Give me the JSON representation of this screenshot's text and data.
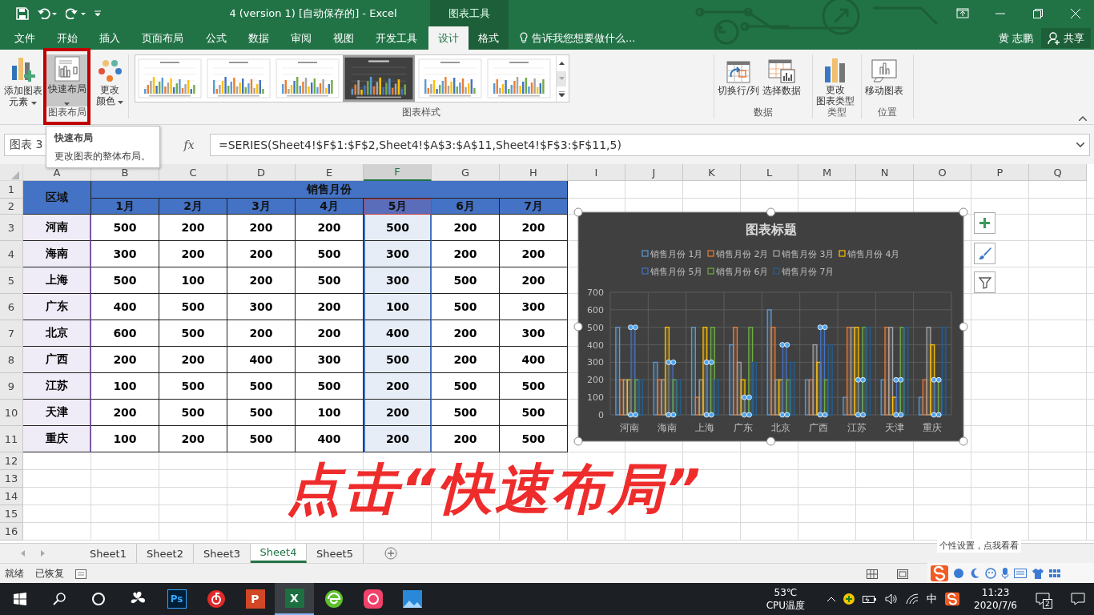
{
  "title_bar": {
    "title": "4 (version 1) [自动保存的] - Excel",
    "context_label": "图表工具"
  },
  "menu_tabs": [
    {
      "label": "文件",
      "selected": false,
      "contextual": false
    },
    {
      "label": "开始",
      "selected": false,
      "contextual": false
    },
    {
      "label": "插入",
      "selected": false,
      "contextual": false
    },
    {
      "label": "页面布局",
      "selected": false,
      "contextual": false
    },
    {
      "label": "公式",
      "selected": false,
      "contextual": false
    },
    {
      "label": "数据",
      "selected": false,
      "contextual": false
    },
    {
      "label": "审阅",
      "selected": false,
      "contextual": false
    },
    {
      "label": "视图",
      "selected": false,
      "contextual": false
    },
    {
      "label": "开发工具",
      "selected": false,
      "contextual": false
    },
    {
      "label": "设计",
      "selected": true,
      "contextual": true
    },
    {
      "label": "格式",
      "selected": false,
      "contextual": true
    }
  ],
  "tell_me": {
    "placeholder": "告诉我您想要做什么..."
  },
  "user": {
    "name": "黄 志鹏"
  },
  "share_button": {
    "label": "共享"
  },
  "ribbon": {
    "groups": [
      {
        "label": "图表布局",
        "kind": "buttons",
        "buttons": [
          {
            "kind": "add-element",
            "lines": [
              "添加图表",
              "元素"
            ],
            "dropdown": true,
            "highlighted": false
          },
          {
            "kind": "quick-layout",
            "lines": [
              "快速布局"
            ],
            "dropdown": true,
            "highlighted": true
          },
          {
            "kind": "colors",
            "lines": [
              "更改",
              "颜色"
            ],
            "dropdown": true,
            "highlighted": false
          }
        ]
      },
      {
        "label": "图表样式",
        "kind": "gallery",
        "styles": [
          {
            "kind": "light",
            "selected": false
          },
          {
            "kind": "light",
            "selected": false
          },
          {
            "kind": "light",
            "selected": false
          },
          {
            "kind": "dark",
            "selected": true
          },
          {
            "kind": "light",
            "selected": false
          },
          {
            "kind": "light",
            "selected": false
          }
        ]
      },
      {
        "label": "数据",
        "kind": "buttons",
        "buttons": [
          {
            "kind": "switch",
            "lines": [
              "切换行/列"
            ]
          },
          {
            "kind": "select-data",
            "lines": [
              "选择数据"
            ]
          }
        ]
      },
      {
        "label": "类型",
        "kind": "buttons",
        "buttons": [
          {
            "kind": "change-type",
            "lines": [
              "更改",
              "图表类型"
            ]
          }
        ]
      },
      {
        "label": "位置",
        "kind": "buttons",
        "buttons": [
          {
            "kind": "move",
            "lines": [
              "移动图表"
            ]
          }
        ]
      }
    ]
  },
  "tooltip": {
    "title": "快速布局",
    "description": "更改图表的整体布局。"
  },
  "formula_bar": {
    "name_box": "图表 3",
    "function_label": "fx",
    "formula": "=SERIES(Sheet4!$F$1:$F$2,Sheet4!$A$3:$A$11,Sheet4!$F$3:$F$11,5)"
  },
  "sheet": {
    "columns": [
      {
        "label": "A",
        "selected": false
      },
      {
        "label": "B",
        "selected": false
      },
      {
        "label": "C",
        "selected": false
      },
      {
        "label": "D",
        "selected": false
      },
      {
        "label": "E",
        "selected": false
      },
      {
        "label": "F",
        "selected": true
      },
      {
        "label": "G",
        "selected": false
      },
      {
        "label": "H",
        "selected": false
      },
      {
        "label": "I",
        "selected": false
      },
      {
        "label": "J",
        "selected": false
      },
      {
        "label": "K",
        "selected": false
      },
      {
        "label": "L",
        "selected": false
      },
      {
        "label": "M",
        "selected": false
      },
      {
        "label": "N",
        "selected": false
      },
      {
        "label": "O",
        "selected": false
      },
      {
        "label": "P",
        "selected": false
      },
      {
        "label": "Q",
        "selected": false
      }
    ],
    "row_numbers": [
      "1",
      "2",
      "3",
      "4",
      "5",
      "6",
      "7",
      "8",
      "9",
      "10",
      "11",
      "12",
      "13",
      "14",
      "15",
      "16"
    ],
    "table": {
      "corner_header": "区域",
      "group_header": "销售月份",
      "months": [
        {
          "label": "1月",
          "selected": false
        },
        {
          "label": "2月",
          "selected": false
        },
        {
          "label": "3月",
          "selected": false
        },
        {
          "label": "4月",
          "selected": false
        },
        {
          "label": "5月",
          "selected": true
        },
        {
          "label": "6月",
          "selected": false
        },
        {
          "label": "7月",
          "selected": false
        }
      ],
      "rows": [
        {
          "region": "河南",
          "values": [
            "500",
            "200",
            "200",
            "200",
            "500",
            "200",
            "200"
          ]
        },
        {
          "region": "海南",
          "values": [
            "300",
            "200",
            "200",
            "500",
            "300",
            "200",
            "200"
          ]
        },
        {
          "region": "上海",
          "values": [
            "500",
            "100",
            "200",
            "500",
            "300",
            "500",
            "200"
          ]
        },
        {
          "region": "广东",
          "values": [
            "400",
            "500",
            "300",
            "200",
            "100",
            "500",
            "300"
          ]
        },
        {
          "region": "北京",
          "values": [
            "600",
            "500",
            "200",
            "200",
            "400",
            "200",
            "300"
          ]
        },
        {
          "region": "广西",
          "values": [
            "200",
            "200",
            "400",
            "300",
            "500",
            "200",
            "400"
          ]
        },
        {
          "region": "江苏",
          "values": [
            "100",
            "500",
            "500",
            "500",
            "200",
            "500",
            "500"
          ]
        },
        {
          "region": "天津",
          "values": [
            "200",
            "500",
            "500",
            "100",
            "200",
            "500",
            "500"
          ]
        },
        {
          "region": "重庆",
          "values": [
            "100",
            "200",
            "500",
            "400",
            "200",
            "200",
            "500"
          ]
        }
      ]
    }
  },
  "chart": {
    "chart_data": {
      "type": "bar",
      "title": "图表标题",
      "categories": [
        "河南",
        "海南",
        "上海",
        "广东",
        "北京",
        "广西",
        "江苏",
        "天津",
        "重庆"
      ],
      "series": [
        {
          "name": "销售月份 1月",
          "color": "#5b9bd5",
          "values": [
            500,
            300,
            500,
            400,
            600,
            200,
            100,
            200,
            100
          ]
        },
        {
          "name": "销售月份 2月",
          "color": "#ed7d31",
          "values": [
            200,
            200,
            100,
            500,
            500,
            200,
            500,
            500,
            200
          ]
        },
        {
          "name": "销售月份 3月",
          "color": "#a5a5a5",
          "values": [
            200,
            200,
            200,
            300,
            200,
            400,
            500,
            500,
            500
          ]
        },
        {
          "name": "销售月份 4月",
          "color": "#ffc000",
          "values": [
            200,
            500,
            500,
            200,
            200,
            300,
            500,
            100,
            400
          ]
        },
        {
          "name": "销售月份 5月",
          "color": "#4472c4",
          "values": [
            500,
            300,
            300,
            100,
            400,
            500,
            200,
            200,
            200
          ]
        },
        {
          "name": "销售月份 6月",
          "color": "#70ad47",
          "values": [
            200,
            200,
            500,
            500,
            200,
            200,
            500,
            500,
            200
          ]
        },
        {
          "name": "销售月份 7月",
          "color": "#255e91",
          "values": [
            200,
            200,
            200,
            300,
            300,
            400,
            500,
            500,
            500
          ]
        }
      ],
      "ylim": [
        0,
        700
      ],
      "yticks": [
        {
          "value": 0,
          "label": "0"
        },
        {
          "value": 100,
          "label": "100"
        },
        {
          "value": 200,
          "label": "200"
        },
        {
          "value": 300,
          "label": "300"
        },
        {
          "value": 400,
          "label": "400"
        },
        {
          "value": 500,
          "label": "500"
        },
        {
          "value": 600,
          "label": "600"
        },
        {
          "value": 700,
          "label": "700"
        }
      ],
      "grid": true,
      "legend": true
    },
    "series_selection": [
      {
        "selected": false
      },
      {
        "selected": false
      },
      {
        "selected": false
      },
      {
        "selected": false
      },
      {
        "selected": true
      },
      {
        "selected": false
      },
      {
        "selected": false
      }
    ]
  },
  "annotation": {
    "caption": "点击“快速布局”"
  },
  "sheet_tabs": [
    {
      "label": "Sheet1",
      "selected": false
    },
    {
      "label": "Sheet2",
      "selected": false
    },
    {
      "label": "Sheet3",
      "selected": false
    },
    {
      "label": "Sheet4",
      "selected": true
    },
    {
      "label": "Sheet5",
      "selected": false
    }
  ],
  "status_bar": {
    "ready": "就绪",
    "recovered": "已恢复"
  },
  "ime_tip": "个性设置，点我看看",
  "taskbar": {
    "apps": [
      {
        "kind": "fan",
        "selected": false
      },
      {
        "kind": "ps",
        "label": "Ps",
        "selected": false
      },
      {
        "kind": "music",
        "selected": false
      },
      {
        "kind": "ppt",
        "label": "P",
        "selected": false
      },
      {
        "kind": "excel",
        "label": "X",
        "selected": true
      },
      {
        "kind": "browser",
        "selected": false
      },
      {
        "kind": "app",
        "selected": false
      },
      {
        "kind": "photos",
        "selected": false
      }
    ],
    "temperature": "53℃",
    "temperature_label": "CPU温度",
    "ime": "中",
    "time": "11:23",
    "date": "2020/7/6",
    "notification_count": "2"
  }
}
